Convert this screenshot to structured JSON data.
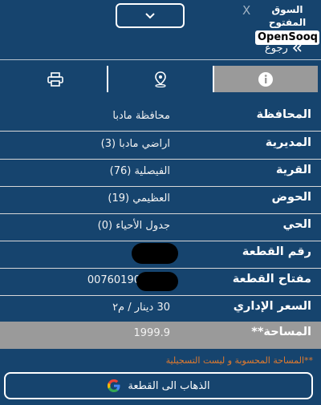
{
  "header": {
    "collapse_icon": "chevron-down-icon",
    "close_label": "X",
    "logo_arabic": "السوق المفتوح",
    "logo_english": "OpenSooq"
  },
  "back": {
    "label": "رجوع",
    "icon": "double-chevron-left-icon"
  },
  "tabs": [
    {
      "icon": "printer-icon",
      "active": false
    },
    {
      "icon": "map-pin-icon",
      "active": false
    },
    {
      "icon": "info-icon",
      "active": true
    }
  ],
  "details": {
    "governorate": {
      "label": "المحافظة",
      "value": "محافظة مادبا"
    },
    "directorate": {
      "label": "المديرية",
      "value": "اراضي مادبا (3)"
    },
    "village": {
      "label": "القرية",
      "value": "الفيصلية (76)"
    },
    "basin": {
      "label": "الحوض",
      "value": "العظيمي (19)"
    },
    "district": {
      "label": "الحي",
      "value": "جدول الأحياء (0)"
    },
    "plot_number": {
      "label": "رقم القطعة",
      "value": ""
    },
    "plot_key": {
      "label": "مفتاح القطعة",
      "value": "00760190"
    },
    "admin_price": {
      "label": "السعر الإداري",
      "value": "30 دينار / م٢"
    },
    "area": {
      "label": "المساحة**",
      "value": "1999.9"
    }
  },
  "note": "**المساحة المحسوبة و ليست التسجيلية",
  "go_button": {
    "label": "الذهاب الى القطعة",
    "icon": "google-icon"
  },
  "colors": {
    "background": "#16446e",
    "highlight": "#9a9a9a",
    "note": "#e07a2e"
  }
}
